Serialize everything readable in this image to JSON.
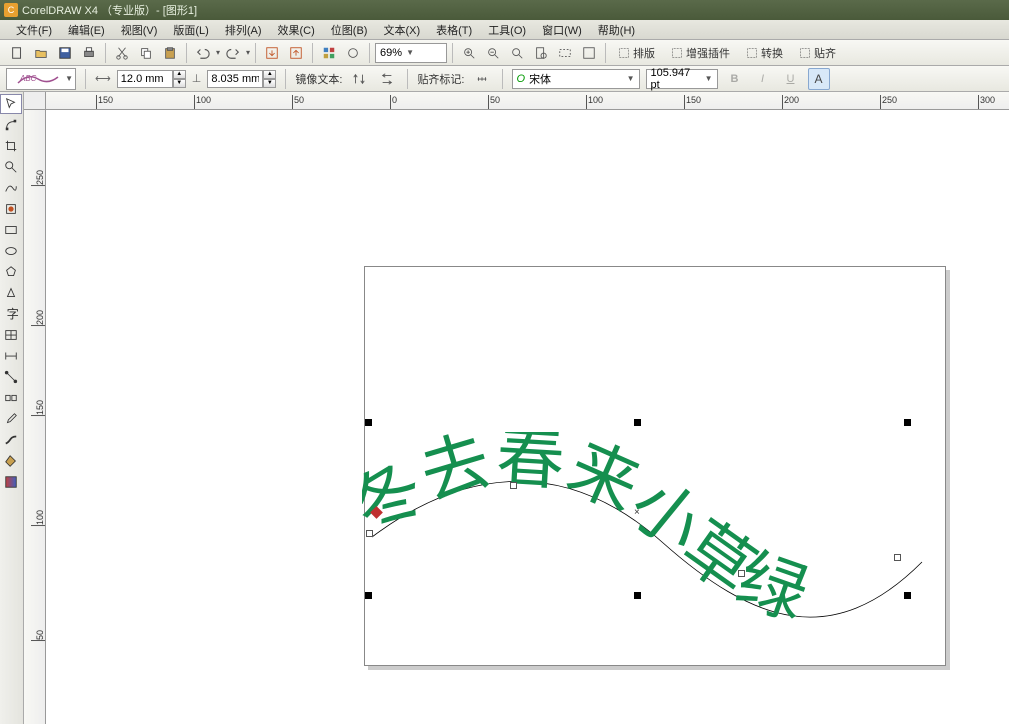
{
  "title": "CorelDRAW X4 （专业版）- [图形1]",
  "menu": [
    "文件(F)",
    "编辑(E)",
    "视图(V)",
    "版面(L)",
    "排列(A)",
    "效果(C)",
    "位图(B)",
    "文本(X)",
    "表格(T)",
    "工具(O)",
    "窗口(W)",
    "帮助(H)"
  ],
  "toolbar": {
    "zoom": "69%",
    "btns": {
      "layout": "排版",
      "plugin": "增强插件",
      "convert": "转换",
      "align": "贴齐"
    }
  },
  "prop": {
    "offset_x": "12.0 mm",
    "offset_y": "8.035 mm",
    "mirror_label": "镜像文本:",
    "snap_label": "贴齐标记:",
    "font": "宋体",
    "size": "105.947 pt"
  },
  "ruler_h": [
    {
      "v": "150",
      "p": 50
    },
    {
      "v": "100",
      "p": 148
    },
    {
      "v": "50",
      "p": 246
    },
    {
      "v": "0",
      "p": 344
    },
    {
      "v": "50",
      "p": 442
    },
    {
      "v": "100",
      "p": 540
    },
    {
      "v": "150",
      "p": 638
    },
    {
      "v": "200",
      "p": 736
    },
    {
      "v": "250",
      "p": 834
    },
    {
      "v": "300",
      "p": 932
    }
  ],
  "ruler_v": [
    {
      "v": "250",
      "p": 60
    },
    {
      "v": "200",
      "p": 200
    },
    {
      "v": "150",
      "p": 290
    },
    {
      "v": "100",
      "p": 400
    },
    {
      "v": "50",
      "p": 520
    }
  ],
  "text_chars": [
    "冬",
    "去",
    "春",
    "来",
    "小",
    "草",
    "绿"
  ],
  "text_color": "#158f4f"
}
